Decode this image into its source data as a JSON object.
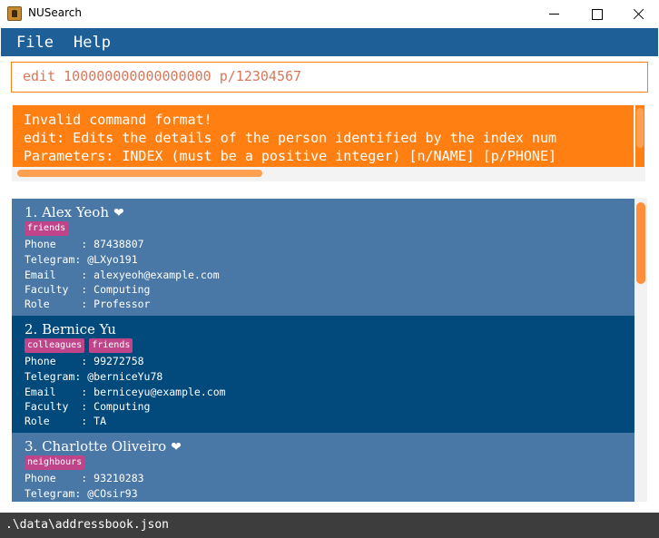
{
  "window": {
    "title": "NUSearch"
  },
  "menu": {
    "file": "File",
    "help": "Help"
  },
  "command": {
    "value": "edit 100000000000000000 p/12304567"
  },
  "result": {
    "lines": [
      "Invalid command format!",
      "edit: Edits the details of the person identified by the index num",
      "Parameters: INDEX (must be a positive integer) [n/NAME] [p/PHONE]"
    ]
  },
  "persons": [
    {
      "name": "1. Alex Yeoh",
      "favourite": "❤",
      "tags": [
        "friends"
      ],
      "phone": "Phone    : 87438807",
      "telegram": "Telegram: @LXyo191",
      "email": "Email    : alexyeoh@example.com",
      "faculty": "Faculty  : Computing",
      "role": "Role     : Professor"
    },
    {
      "name": "2. Bernice Yu",
      "favourite": "",
      "tags": [
        "colleagues",
        "friends"
      ],
      "phone": "Phone    : 99272758",
      "telegram": "Telegram: @berniceYu78",
      "email": "Email    : berniceyu@example.com",
      "faculty": "Faculty  : Computing",
      "role": "Role     : TA"
    },
    {
      "name": "3. Charlotte Oliveiro",
      "favourite": "❤",
      "tags": [
        "neighbours"
      ],
      "phone": "Phone    : 93210283",
      "telegram": "Telegram: @COsir93",
      "email": "",
      "faculty": "",
      "role": ""
    }
  ],
  "status": {
    "path": ".\\data\\addressbook.json"
  },
  "colors": {
    "menu_bg": "#1d5f96",
    "command_border": "#ff7f12",
    "result_bg": "#ff7f12",
    "card_light": "#4a78a6",
    "card_dark": "#034a7c",
    "tag_bg": "#c0448a",
    "status_bg": "#3d3d3d"
  },
  "icons": [
    "app-icon",
    "minimize-icon",
    "maximize-icon",
    "close-icon",
    "heart-icon"
  ]
}
